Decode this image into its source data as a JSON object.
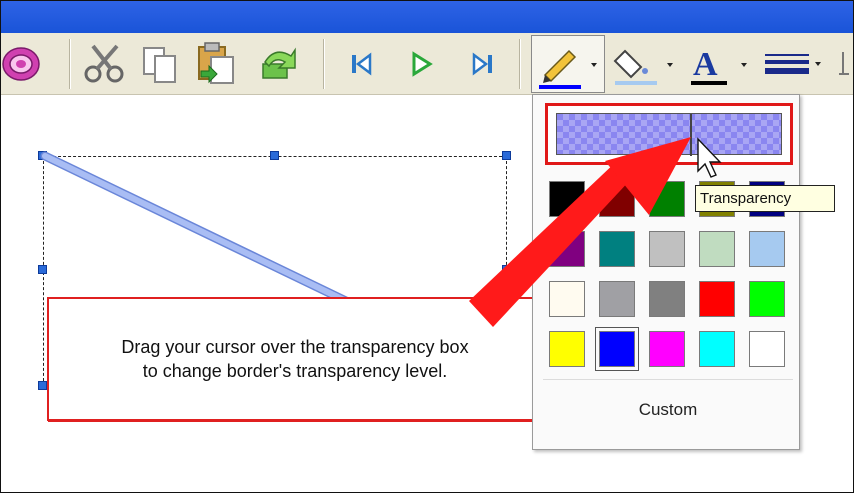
{
  "callout": {
    "line1": "Drag your cursor over the transparency box",
    "line2": "to change border's transparency level."
  },
  "popup": {
    "custom_label": "Custom",
    "transparency_level": 0.6,
    "swatches": [
      "#000000",
      "#800000",
      "#008000",
      "#808000",
      "#000080",
      "#800080",
      "#008080",
      "#c0c0c0",
      "#c0dcc0",
      "#a6caf0",
      "#fffbf0",
      "#a0a0a4",
      "#808080",
      "#ff0000",
      "#00ff00",
      "#ffff00",
      "#0000ff",
      "#ff00ff",
      "#00ffff",
      "#ffffff"
    ],
    "selected_color": "#0000ff"
  },
  "tooltip": {
    "text": "Transparency"
  },
  "colors": {
    "callout_border": "#e02020",
    "arrow": "#ff1a1a",
    "line_color": "#8faaf0",
    "handle": "#2a6ad8",
    "title_bar": "#1a54d8"
  },
  "toolbar": {
    "icons": [
      "disc-icon",
      "cut-icon",
      "copy-icon",
      "paste-icon",
      "undo-icon",
      "first-icon",
      "play-icon",
      "last-icon",
      "pen-color-icon",
      "fill-color-icon",
      "font-color-icon",
      "line-style-icon"
    ]
  }
}
